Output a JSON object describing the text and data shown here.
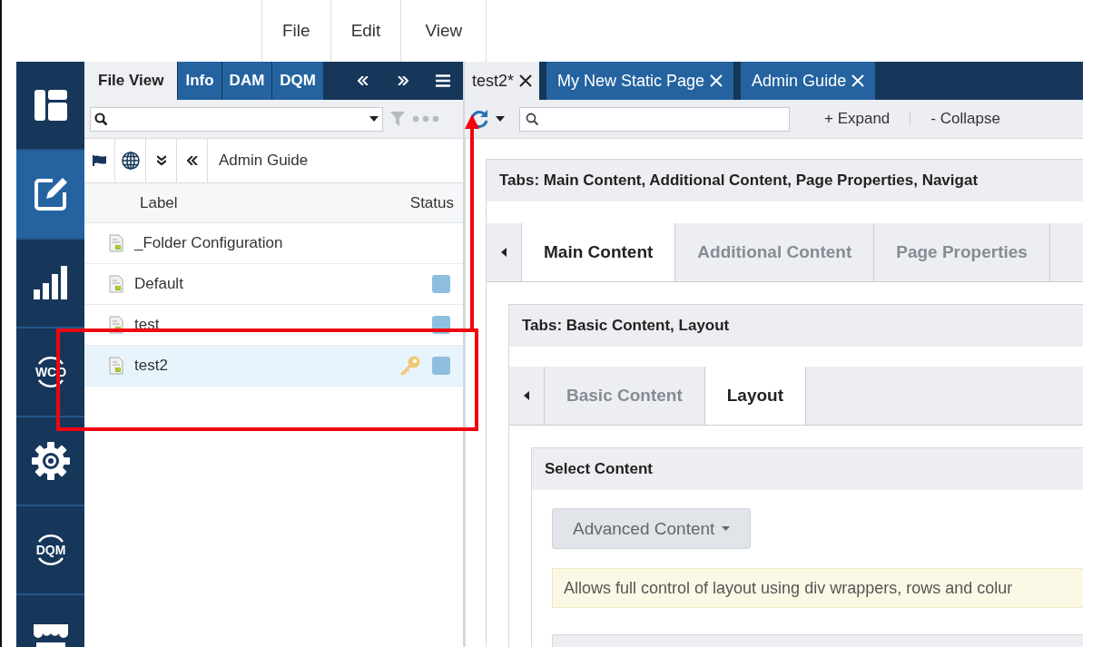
{
  "menu": [
    "File",
    "Edit",
    "View"
  ],
  "rail": {
    "items": [
      {
        "kind": "panels",
        "selected": false
      },
      {
        "kind": "edit",
        "selected": true
      },
      {
        "kind": "chart",
        "selected": false
      },
      {
        "kind": "wco",
        "label": "WCO",
        "selected": false
      },
      {
        "kind": "gear",
        "selected": false
      },
      {
        "kind": "dqm",
        "label": "DQM",
        "selected": false
      },
      {
        "kind": "store",
        "selected": false
      }
    ]
  },
  "panel": {
    "tabs": [
      {
        "label": "File View",
        "selected": true
      },
      {
        "label": "Info",
        "selected": false
      },
      {
        "label": "DAM",
        "selected": false
      },
      {
        "label": "DQM",
        "selected": false
      }
    ],
    "breadcrumb": "Admin Guide",
    "columns": [
      "Label",
      "Status"
    ],
    "rows": [
      {
        "label": "_Folder Configuration",
        "selected": false,
        "locked": false,
        "status": false
      },
      {
        "label": "Default",
        "selected": false,
        "locked": false,
        "status": true
      },
      {
        "label": "test",
        "selected": false,
        "locked": false,
        "status": true
      },
      {
        "label": "test2",
        "selected": true,
        "locked": true,
        "status": true
      }
    ]
  },
  "doc_tabs": [
    {
      "label": "test2*",
      "selected": true
    },
    {
      "label": "My New Static Page",
      "selected": false
    },
    {
      "label": "Admin Guide",
      "selected": false
    }
  ],
  "toolbar": {
    "expand": "+ Expand",
    "collapse": "- Collapse"
  },
  "main": {
    "title": "Tabs: Main Content, Additional Content, Page Properties, Navigat",
    "tabs": [
      {
        "label": "Main Content",
        "selected": true
      },
      {
        "label": "Additional Content",
        "selected": false
      },
      {
        "label": "Page Properties",
        "selected": false
      }
    ],
    "section": {
      "title": "Tabs: Basic Content, Layout",
      "tabs": [
        {
          "label": "Basic Content",
          "selected": false
        },
        {
          "label": "Layout",
          "selected": true
        }
      ],
      "select": {
        "title": "Select Content",
        "button": "Advanced Content",
        "note": "Allows full control of layout using div wrappers, rows and colur"
      }
    }
  }
}
